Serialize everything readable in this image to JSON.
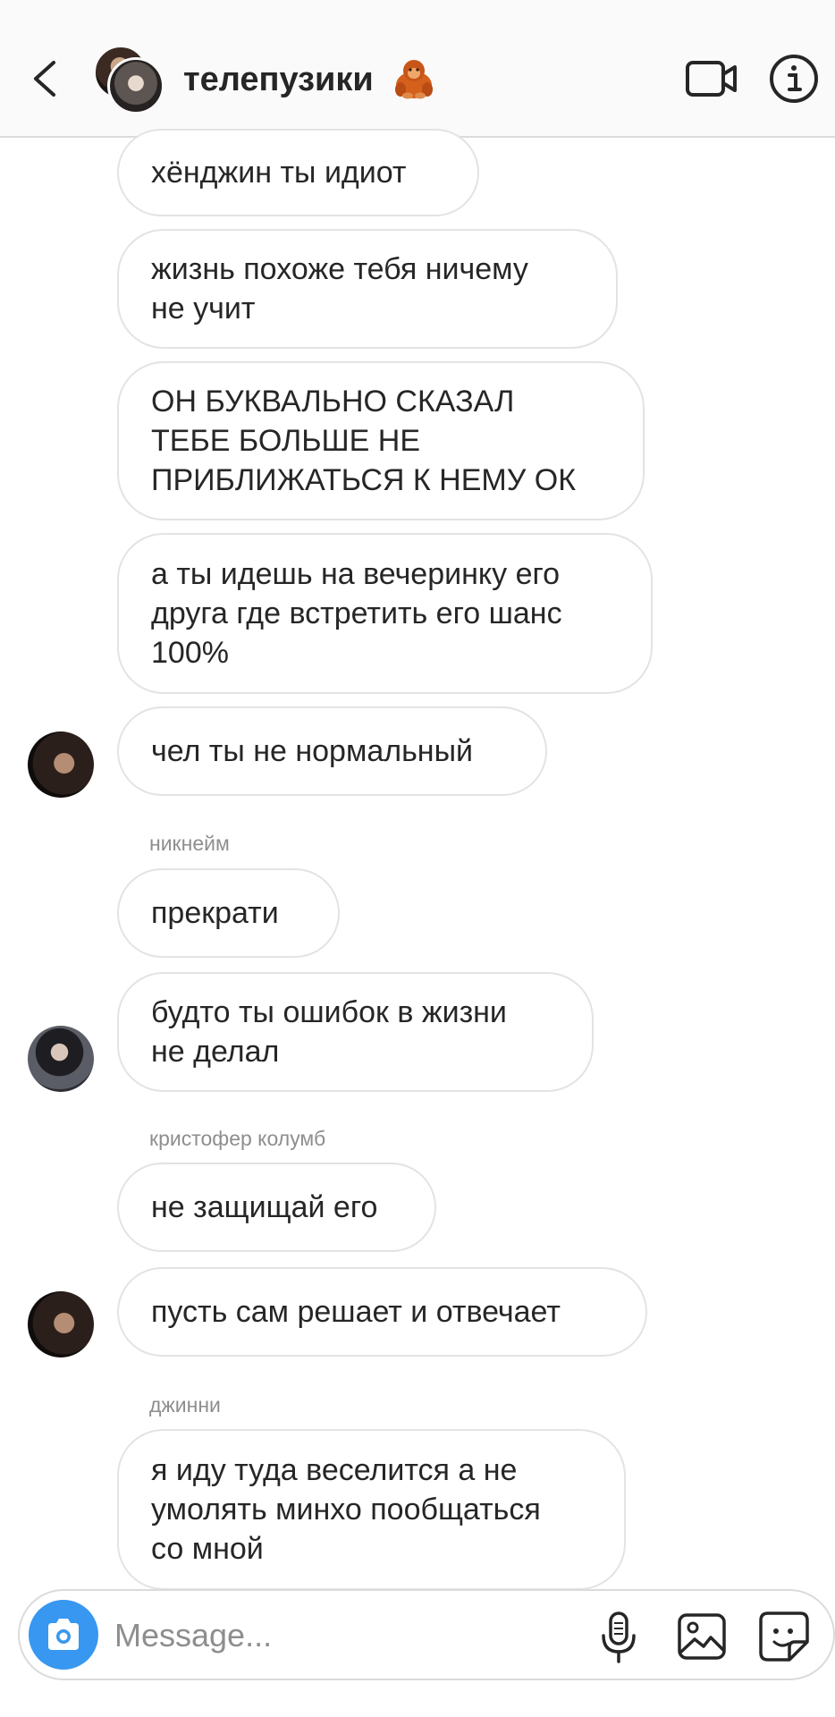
{
  "header": {
    "title": "телепузики",
    "title_emoji": "orangutan-emoji",
    "back_icon": "chevron-left-icon",
    "video_icon": "video-camera-icon",
    "info_icon": "info-icon"
  },
  "messages": [
    {
      "text": "хёнджин ты идиот"
    },
    {
      "text": "жизнь похоже тебя ничему\nне учит"
    },
    {
      "text": "ОН БУКВАЛЬНО СКАЗАЛ\nТЕБЕ БОЛЬШЕ НЕ\nПРИБЛИЖАТЬСЯ К НЕМУ ОК"
    },
    {
      "text": "а ты идешь на вечеринку его\nдруга где встретить его шанс\n100%"
    },
    {
      "text": "чел ты не нормальный"
    },
    {
      "sender": "никнейм",
      "text": "прекрати"
    },
    {
      "text": "будто ты ошибок в жизни\nне делал"
    },
    {
      "sender": "кристофер колумб",
      "text": "не защищай его"
    },
    {
      "text": "пусть сам решает и отвечает"
    },
    {
      "sender": "джинни",
      "text": "я иду туда веселится а не\nумолять минхо пообщаться\nсо мной"
    }
  ],
  "input": {
    "placeholder": "Message...",
    "value": ""
  },
  "colors": {
    "header_bg": "#fafafa",
    "bubble_border": "#e3e3e3",
    "accent": "#3897f0",
    "secondary_text": "#8e8e8e"
  }
}
